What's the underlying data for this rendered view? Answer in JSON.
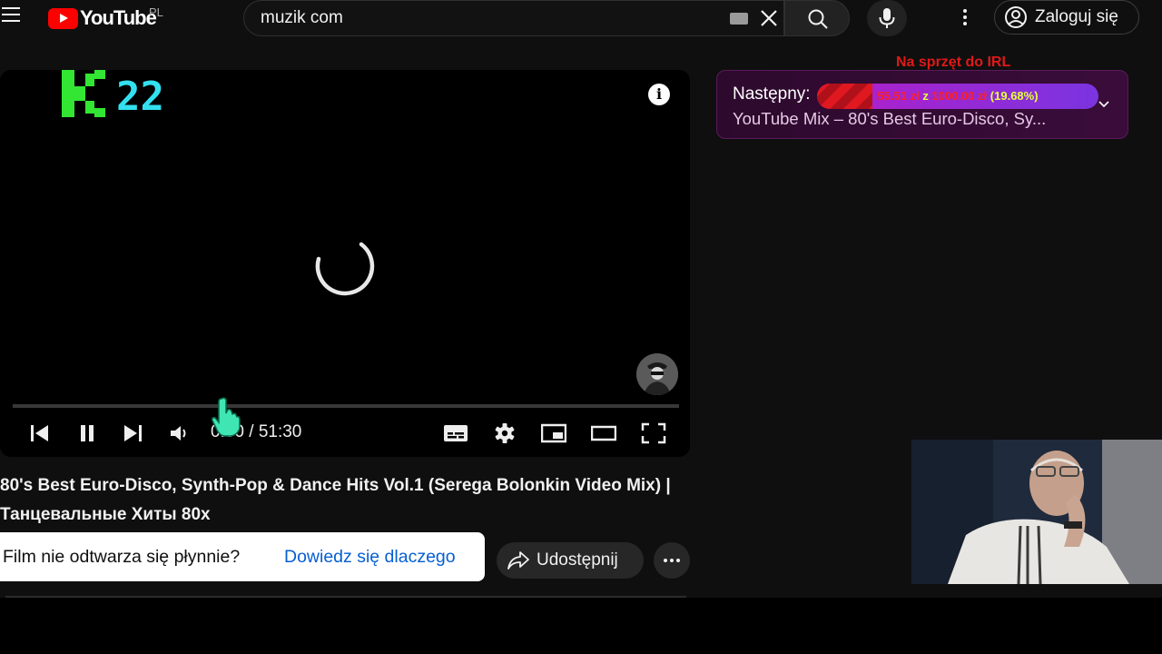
{
  "header": {
    "logo_text": "YouTube",
    "region": "PL",
    "search_value": "muzik com",
    "login_label": "Zaloguj się"
  },
  "player": {
    "channel_number": "22",
    "info_glyph": "i",
    "time_current": "0:00",
    "time_separator": "/",
    "time_total": "51:30",
    "progress_fraction": 0.0
  },
  "video": {
    "title": "80's Best Euro-Disco, Synth-Pop & Dance Hits Vol.1 (Serega Bolonkin Video Mix) | Танцевальные Хиты 80х"
  },
  "tooltip": {
    "question": "Film nie odtwarza się płynnie?",
    "link": "Dowiedz się dlaczego"
  },
  "actions": {
    "share_label": "Udostępnij"
  },
  "up_next": {
    "overlay_text": "Na sprzęt do IRL",
    "label": "Następny:",
    "title": "YouTube Mix – 80's Best Euro-Disco, Sy...",
    "goal_amount": "55.51 zł",
    "goal_of": "z",
    "goal_target": "1000.00 zł",
    "goal_percent_text": "(19.68%)",
    "goal_fraction": 0.1968
  },
  "colors": {
    "background": "#0f0f0f",
    "youtube_red": "#ff0000",
    "link_blue": "#065fd4",
    "upnext_bg": "#3a0c3a",
    "k_logo_green": "#33e633",
    "channel_number_cyan": "#33e0f0"
  },
  "icons": {
    "menu": "hamburger-icon",
    "keyboard": "keyboard-icon",
    "clear": "close-icon",
    "search": "search-icon",
    "mic": "microphone-icon",
    "more": "kebab-icon",
    "account": "account-icon",
    "prev": "previous-icon",
    "pause": "pause-icon",
    "next": "next-icon",
    "volume": "volume-icon",
    "subtitles": "subtitles-icon",
    "settings": "gear-icon",
    "miniplayer": "miniplayer-icon",
    "theater": "theater-icon",
    "fullscreen": "fullscreen-icon",
    "share": "share-icon",
    "chevron": "chevron-down-icon"
  }
}
